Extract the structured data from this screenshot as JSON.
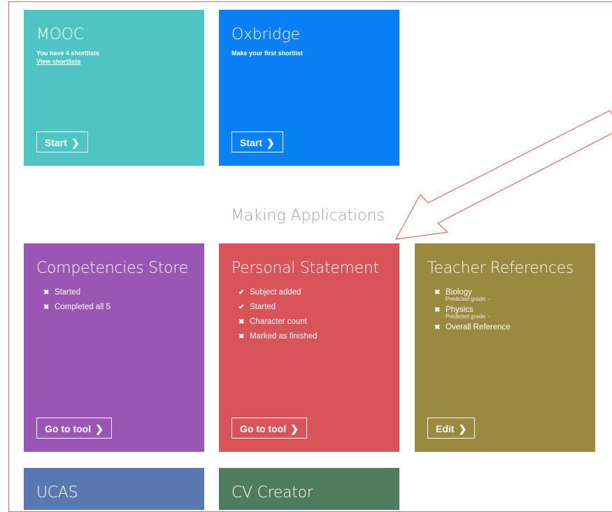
{
  "colors": {
    "mooc": "#4fc4c4",
    "oxbridge": "#0a80f5",
    "competencies": "#9a55b5",
    "personal": "#d9535a",
    "teacher": "#9a893e",
    "ucas": "#5a78b0",
    "cv": "#4f7c5e",
    "annotation": "#e06a6a"
  },
  "cards": {
    "mooc": {
      "title": "MOOC",
      "subtitle": "You have 4 shortlists",
      "link": "View shortlists",
      "button": "Start"
    },
    "oxbridge": {
      "title": "Oxbridge",
      "subtitle": "Make your first shortlist",
      "button": "Start"
    },
    "competencies": {
      "title": "Competencies Store",
      "items": [
        {
          "icon": "cross-icon",
          "label": "Started"
        },
        {
          "icon": "cross-icon",
          "label": "Completed all 5"
        }
      ],
      "button": "Go to tool"
    },
    "personal": {
      "title": "Personal Statement",
      "items": [
        {
          "icon": "check-icon",
          "label": "Subject added"
        },
        {
          "icon": "check-icon",
          "label": "Started"
        },
        {
          "icon": "cross-icon",
          "label": "Character count"
        },
        {
          "icon": "cross-icon",
          "label": "Marked as finished"
        }
      ],
      "button": "Go to tool"
    },
    "teacher": {
      "title": "Teacher References",
      "items": [
        {
          "icon": "cross-icon",
          "label": "Biology",
          "note": "Predicted grade: -"
        },
        {
          "icon": "cross-icon",
          "label": "Physics",
          "note": "Predicted grade: -"
        },
        {
          "icon": "cross-icon",
          "label": "Overall Reference"
        }
      ],
      "button": "Edit"
    },
    "ucas": {
      "title": "UCAS"
    },
    "cv": {
      "title": "CV Creator"
    }
  },
  "section": {
    "title": "Making Applications"
  },
  "glyphs": {
    "chevron": "❯",
    "check": "✔",
    "cross": "✖"
  }
}
